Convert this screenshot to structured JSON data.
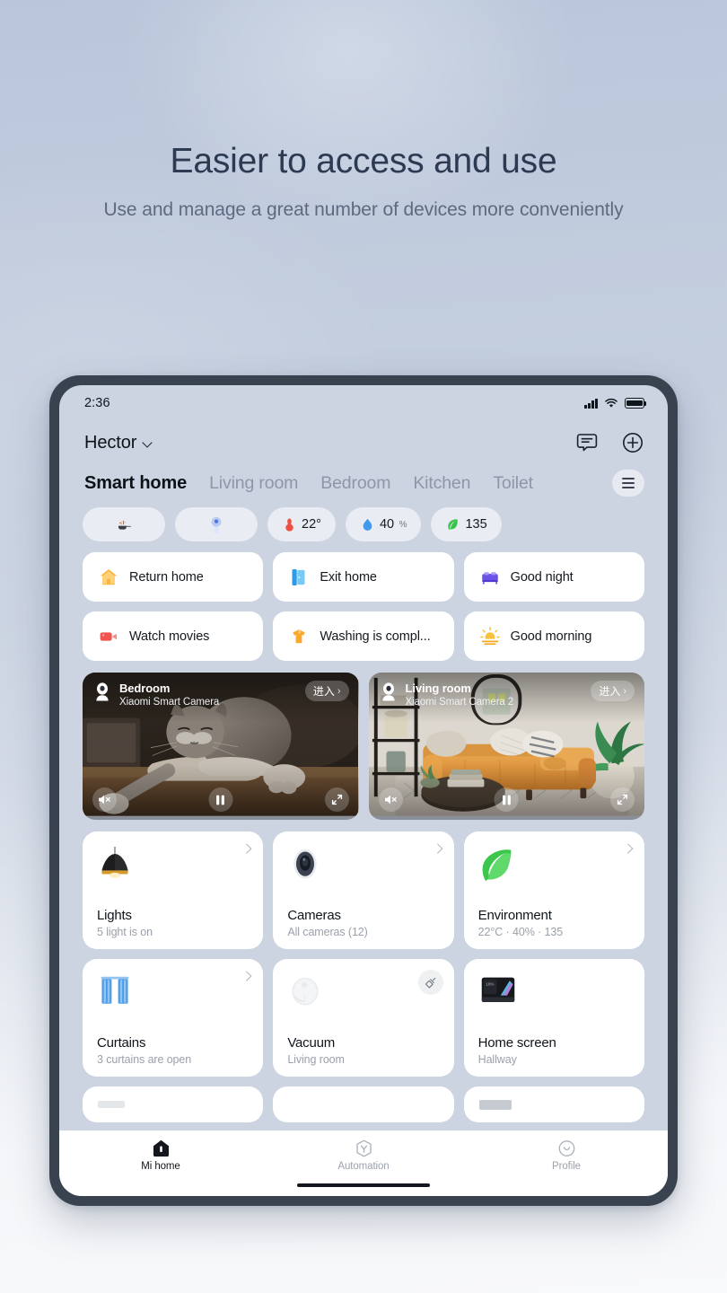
{
  "hero": {
    "title": "Easier to access and use",
    "subtitle": "Use and manage a great number of devices more conveniently"
  },
  "statusbar": {
    "time": "2:36",
    "icons": [
      "signal-icon",
      "wifi-icon",
      "battery-icon"
    ]
  },
  "app_header": {
    "home_name": "Hector",
    "chevron": "chevron-down-icon",
    "actions": [
      "message-icon",
      "add-icon"
    ]
  },
  "tabs": {
    "items": [
      {
        "label": "Smart home",
        "active": true
      },
      {
        "label": "Living room",
        "active": false
      },
      {
        "label": "Bedroom",
        "active": false
      },
      {
        "label": "Kitchen",
        "active": false
      },
      {
        "label": "Toilet",
        "active": false
      }
    ],
    "menu_icon": "hamburger-menu-icon"
  },
  "chips": [
    {
      "icon": "cooking-pan-icon",
      "value": "",
      "unit": ""
    },
    {
      "icon": "lamp-light-icon",
      "value": "",
      "unit": ""
    },
    {
      "icon": "thermometer-icon",
      "value": "22°",
      "unit": ""
    },
    {
      "icon": "water-drop-icon",
      "value": "40",
      "unit": "%"
    },
    {
      "icon": "leaf-icon",
      "value": "135",
      "unit": ""
    }
  ],
  "scenes": [
    {
      "label": "Return home",
      "icon": "house-icon"
    },
    {
      "label": "Exit home",
      "icon": "door-icon"
    },
    {
      "label": "Good night",
      "icon": "bed-icon"
    },
    {
      "label": "Watch movies",
      "icon": "video-camera-icon"
    },
    {
      "label": "Washing is compl...",
      "icon": "laundry-shirt-icon"
    },
    {
      "label": "Good morning",
      "icon": "sunrise-icon"
    }
  ],
  "cameras": [
    {
      "name": "Bedroom",
      "device": "Xiaomi Smart Camera",
      "enter_label": "进入",
      "controls": [
        "mute-icon",
        "pause-icon",
        "fullscreen-icon"
      ]
    },
    {
      "name": "Living room",
      "device": "Xiaomi Smart Camera 2",
      "enter_label": "进入",
      "controls": [
        "mute-icon",
        "pause-icon",
        "fullscreen-icon"
      ]
    }
  ],
  "devices": [
    {
      "title": "Lights",
      "subtitle": "5 light is on",
      "icon": "pendant-lamp-icon",
      "action": "chevron"
    },
    {
      "title": "Cameras",
      "subtitle": "All cameras (12)",
      "icon": "security-camera-icon",
      "action": "chevron"
    },
    {
      "title": "Environment",
      "subtitle": "22°C · 40% · 135",
      "icon": "leaf-icon",
      "action": "chevron"
    },
    {
      "title": "Curtains",
      "subtitle": "3 curtains are open",
      "icon": "curtains-icon",
      "action": "chevron"
    },
    {
      "title": "Vacuum",
      "subtitle": "Living room",
      "icon": "robot-vacuum-icon",
      "action": "vacuum-button"
    },
    {
      "title": "Home screen",
      "subtitle": "Hallway",
      "icon": "smart-display-icon",
      "action": "none"
    }
  ],
  "bottom_nav": [
    {
      "label": "Mi home",
      "icon": "home-icon",
      "active": true
    },
    {
      "label": "Automation",
      "icon": "automation-icon",
      "active": false
    },
    {
      "label": "Profile",
      "icon": "profile-icon",
      "active": false
    }
  ],
  "colors": {
    "page_bg_top": "#b9c6da",
    "page_bg_bottom": "#f8f9fb",
    "bezel": "#39434f",
    "screen_bg": "#ccd4e1",
    "card": "#ffffff",
    "accent_text": "#0c1118",
    "muted_text": "#9aa1ab"
  }
}
